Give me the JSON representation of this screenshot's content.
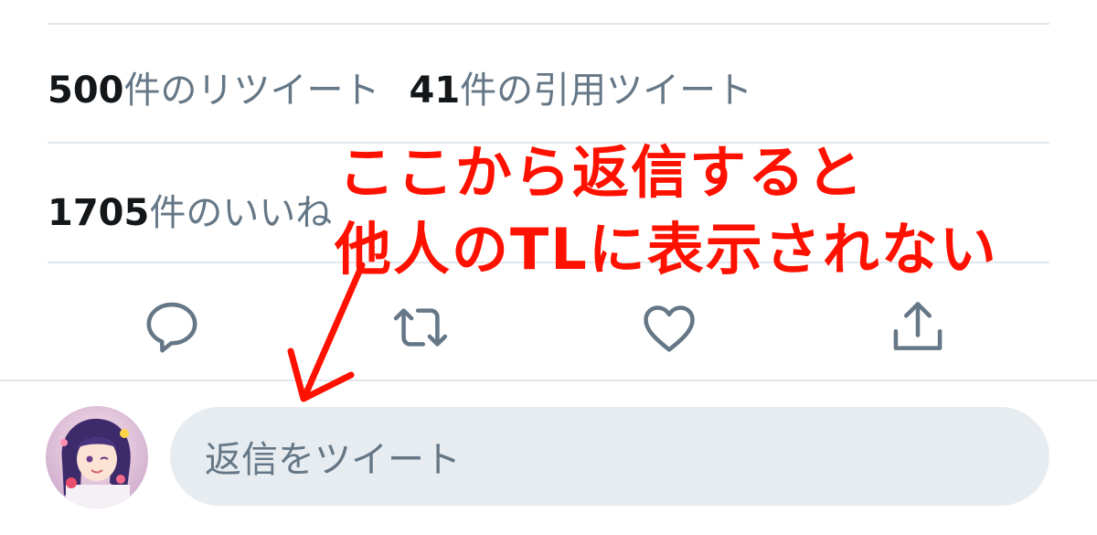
{
  "stats": {
    "retweets": {
      "count": "500",
      "label": "件のリツイート"
    },
    "quotes": {
      "count": "41",
      "label": "件の引用ツイート"
    },
    "likes": {
      "count": "1705",
      "label": "件のいいね"
    }
  },
  "actions": [
    {
      "name": "reply",
      "icon": "speech-bubble-icon"
    },
    {
      "name": "retweet",
      "icon": "retweet-icon"
    },
    {
      "name": "like",
      "icon": "heart-icon"
    },
    {
      "name": "share",
      "icon": "share-icon"
    }
  ],
  "reply": {
    "placeholder": "返信をツイート",
    "avatar": "user-avatar"
  },
  "annotation": {
    "line1": "ここから返信すると",
    "line2": "他人のTLに表示されない",
    "color": "#ff1100"
  },
  "colors": {
    "icon": "#657786",
    "divider": "#e1e8ed",
    "input_bg": "#e6ecf0"
  }
}
